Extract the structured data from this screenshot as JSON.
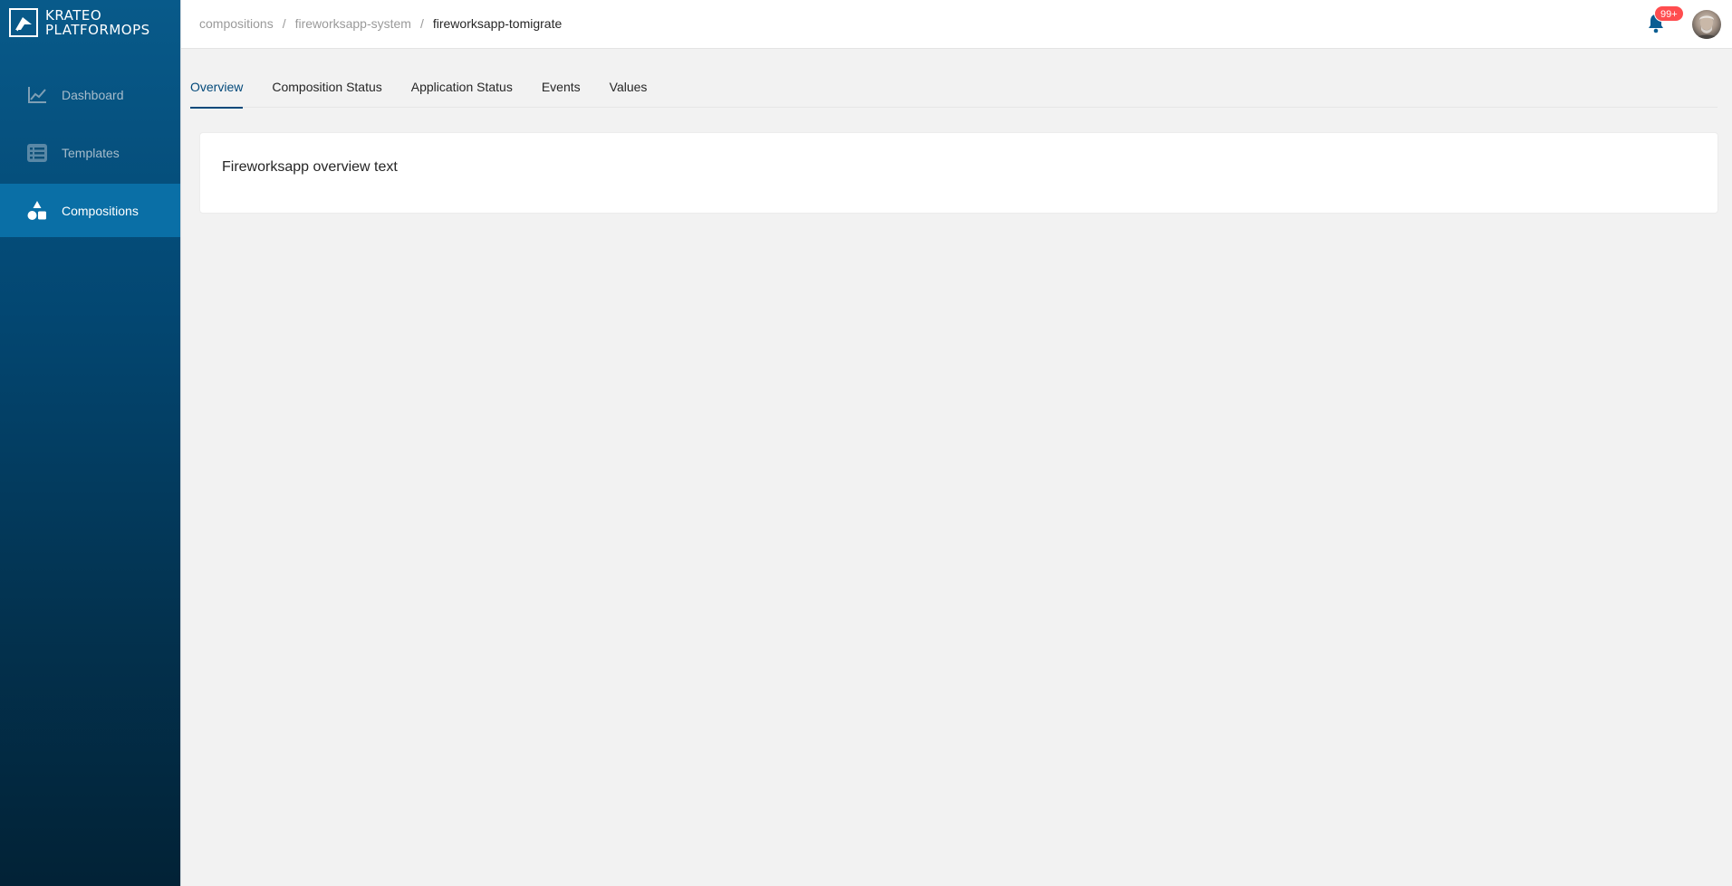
{
  "brand": {
    "logo_line1": "KRATEO",
    "logo_line2": "PLATFORMOPS",
    "icon": "krateo-logo-icon"
  },
  "sidebar": {
    "items": [
      {
        "label": "Dashboard",
        "icon": "line-chart-icon",
        "active": false
      },
      {
        "label": "Templates",
        "icon": "list-icon",
        "active": false
      },
      {
        "label": "Compositions",
        "icon": "shapes-icon",
        "active": true
      }
    ]
  },
  "breadcrumb": {
    "items": [
      "compositions",
      "fireworksapp-system",
      "fireworksapp-tomigrate"
    ],
    "separator": "/"
  },
  "header": {
    "notification_icon": "bell-icon",
    "notification_count": "99+",
    "avatar_icon": "user-avatar"
  },
  "tabs": {
    "items": [
      {
        "label": "Overview",
        "active": true
      },
      {
        "label": "Composition Status",
        "active": false
      },
      {
        "label": "Application Status",
        "active": false
      },
      {
        "label": "Events",
        "active": false
      },
      {
        "label": "Values",
        "active": false
      }
    ]
  },
  "overview": {
    "text": "Fireworksapp overview text"
  },
  "colors": {
    "accent": "#03497a",
    "sidebar_active": "#0a6fa6",
    "badge": "#ff4d4f",
    "background": "#f2f2f2"
  }
}
